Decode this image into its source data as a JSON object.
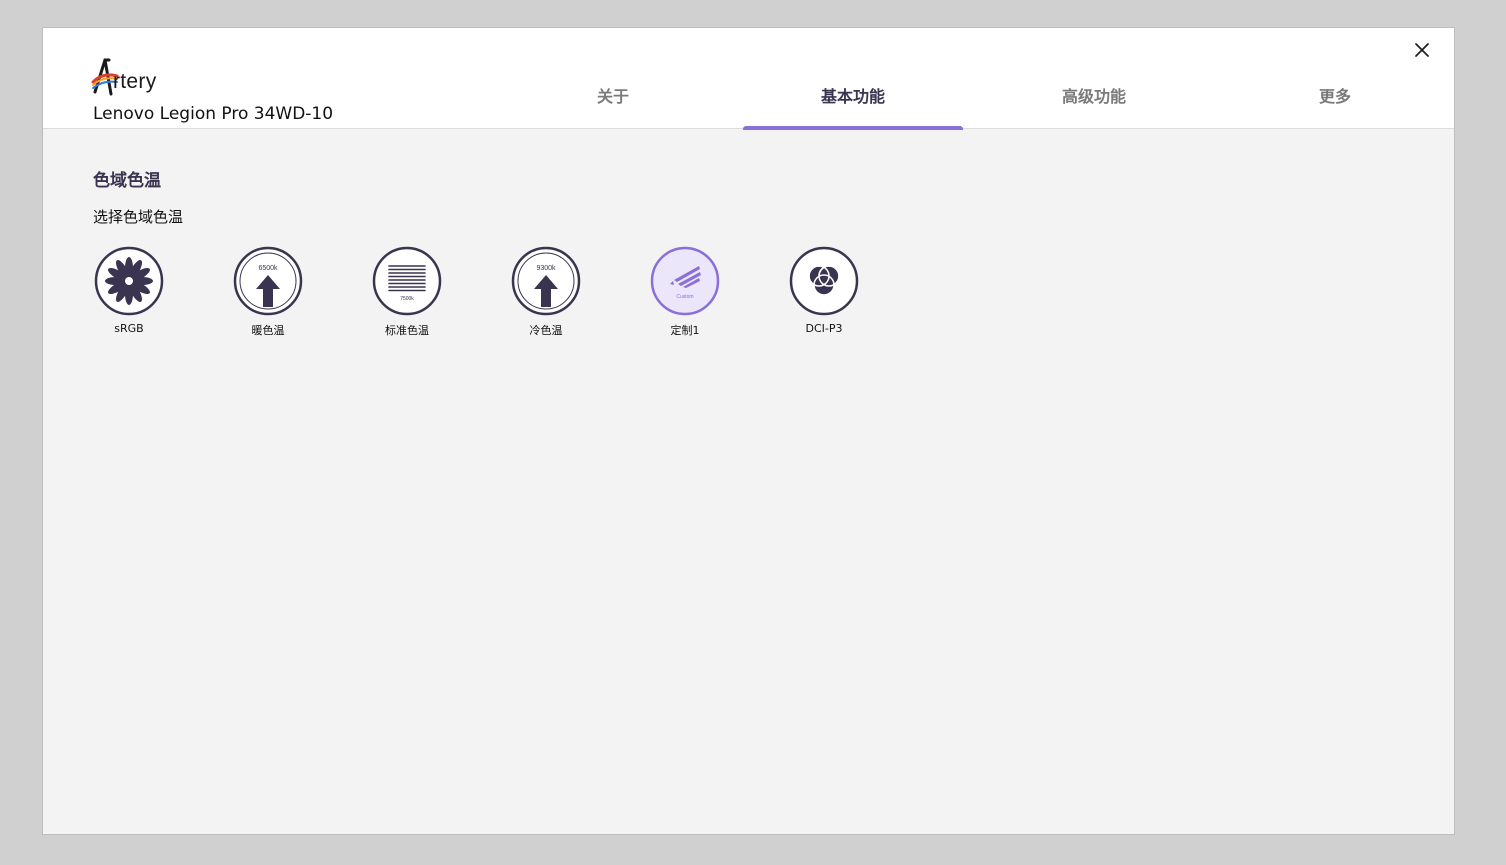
{
  "app": {
    "logo_text": "rtery",
    "logo_letter": "A",
    "device_name": "Lenovo Legion Pro 34WD-10"
  },
  "tabs": [
    {
      "label": "关于",
      "active": false
    },
    {
      "label": "基本功能",
      "active": true
    },
    {
      "label": "高级功能",
      "active": false
    },
    {
      "label": "更多",
      "active": false
    }
  ],
  "section": {
    "title": "色域色温",
    "subtitle": "选择色域色温"
  },
  "modes": [
    {
      "label": "sRGB",
      "icon": "flower-icon",
      "selected": false
    },
    {
      "label": "暖色温",
      "icon": "arrow-up-icon",
      "icon_text": "6500k",
      "selected": false
    },
    {
      "label": "标准色温",
      "icon": "lines-icon",
      "icon_text": "7500k",
      "selected": false
    },
    {
      "label": "冷色温",
      "icon": "arrow-up-icon",
      "icon_text": "9300k",
      "selected": false
    },
    {
      "label": "定制1",
      "icon": "custom-icon",
      "icon_text": "Custom",
      "selected": true
    },
    {
      "label": "DCI-P3",
      "icon": "venn-icon",
      "selected": false
    }
  ],
  "colors": {
    "accent": "#8a6fd8",
    "icon_dark": "#3b3450",
    "selected_fill": "#ece6fb"
  }
}
